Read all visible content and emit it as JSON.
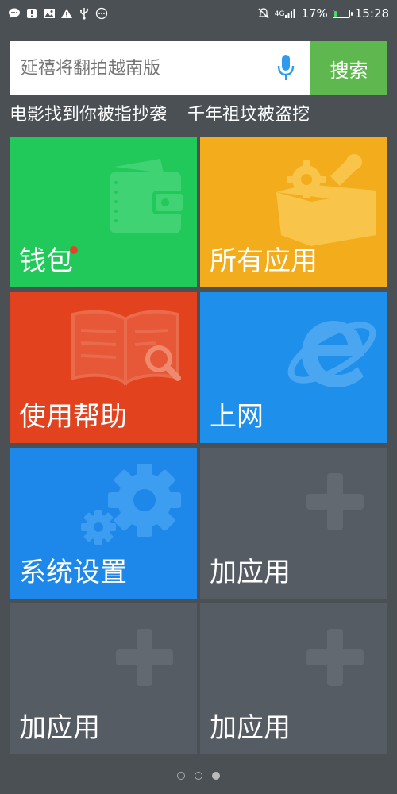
{
  "status_bar": {
    "network": "4G",
    "battery_percent": "17%",
    "battery_level": 0.17,
    "time": "15:28",
    "left_icons": [
      "message-icon",
      "alert-icon",
      "image-icon",
      "warning-icon",
      "usb-icon",
      "more-icon"
    ]
  },
  "search": {
    "placeholder": "延禧将翻拍越南版",
    "button_label": "搜索"
  },
  "hotwords": [
    "电影找到你被指抄袭",
    "千年祖坟被盗挖"
  ],
  "tiles": [
    {
      "label": "钱包",
      "icon": "wallet-icon",
      "color": "#21c85a"
    },
    {
      "label": "所有应用",
      "icon": "toolbox-icon",
      "color": "#f3ac1b"
    },
    {
      "label": "使用帮助",
      "icon": "book-search-icon",
      "color": "#e2431e"
    },
    {
      "label": "上网",
      "icon": "browser-icon",
      "color": "#1f8fec"
    },
    {
      "label": "系统设置",
      "icon": "gear-icon",
      "color": "#1e88ea"
    },
    {
      "label": "加应用",
      "icon": "plus-icon",
      "color": "#565c63"
    },
    {
      "label": "加应用",
      "icon": "plus-icon",
      "color": "#565c63"
    },
    {
      "label": "加应用",
      "icon": "plus-icon",
      "color": "#565c63"
    }
  ],
  "pager": {
    "pages": 3,
    "active": 3
  }
}
